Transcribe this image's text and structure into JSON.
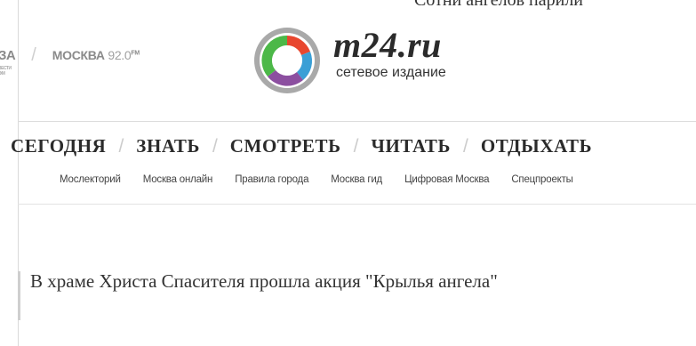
{
  "top_headline_cut": "Сотни ангелов парили",
  "radio": {
    "first": "ЗА",
    "first_sub": "ВЕСТИ ФМ",
    "second": "МОСКВА",
    "second_freq": "92.0",
    "second_sup": "FM"
  },
  "brand": {
    "name": "m24.ru",
    "subtitle": "сетевое издание",
    "logo_colors": [
      "#a0a0a0",
      "#e8472f",
      "#8c4fa0",
      "#3a9fd6",
      "#4cb848"
    ]
  },
  "main_nav": [
    "СЕГОДНЯ",
    "ЗНАТЬ",
    "СМОТРЕТЬ",
    "ЧИТАТЬ",
    "ОТДЫХАТЬ"
  ],
  "sub_nav": [
    "Мослекторий",
    "Москва онлайн",
    "Правила города",
    "Москва гид",
    "Цифровая Москва",
    "Спецпроекты"
  ],
  "article": {
    "title": "В храме Христа Спасителя прошла акция \"Крылья ангела\""
  }
}
